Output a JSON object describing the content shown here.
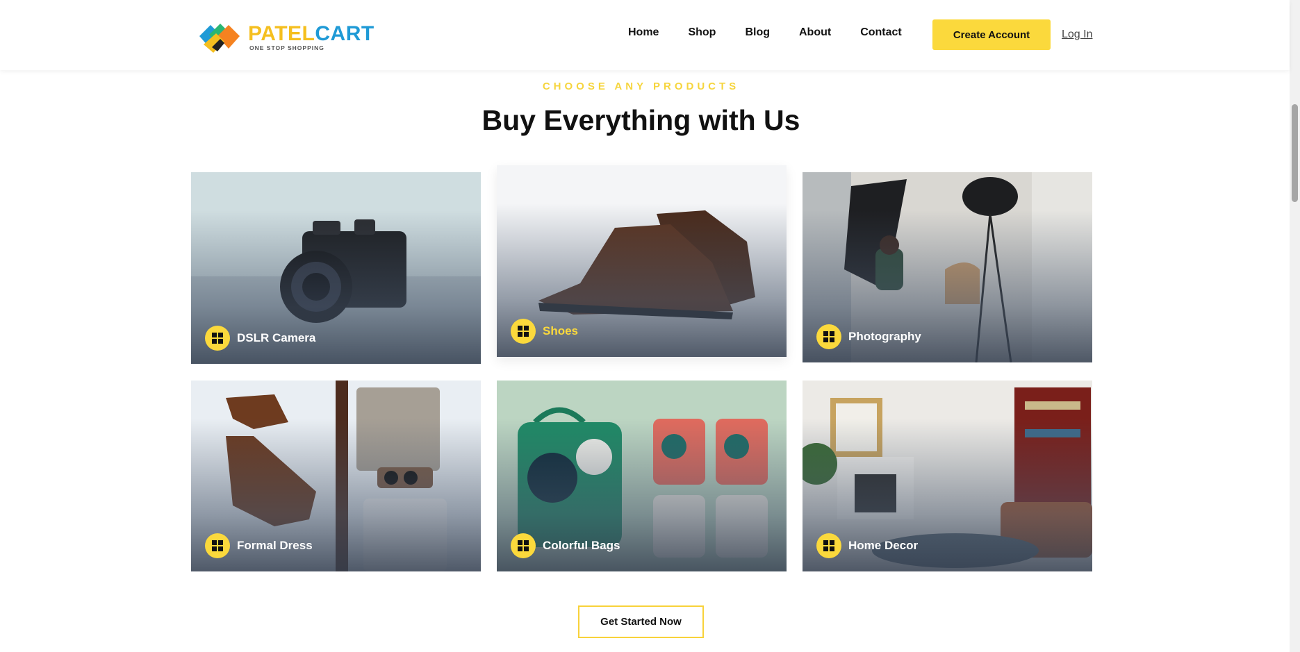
{
  "header": {
    "brand_part1": "PATEL",
    "brand_part2": "CART",
    "tagline": "ONE STOP SHOPPING",
    "nav": [
      "Home",
      "Shop",
      "Blog",
      "About",
      "Contact"
    ],
    "create_account": "Create Account",
    "login": "Log In"
  },
  "section": {
    "eyebrow": "CHOOSE ANY PRODUCTS",
    "title": "Buy Everything with Us"
  },
  "categories": [
    {
      "name": "DSLR Camera",
      "icon": "windows-icon"
    },
    {
      "name": "Shoes",
      "icon": "windows-icon"
    },
    {
      "name": "Photography",
      "icon": "windows-icon"
    },
    {
      "name": "Formal Dress",
      "icon": "windows-icon"
    },
    {
      "name": "Colorful Bags",
      "icon": "windows-icon"
    },
    {
      "name": "Home Decor",
      "icon": "windows-icon"
    }
  ],
  "cta": {
    "label": "Get Started Now"
  },
  "colors": {
    "accent": "#fbd93c",
    "brand_blue": "#1f9ad6",
    "brand_yellow": "#f5bf1f",
    "overlay": "#343f50"
  }
}
